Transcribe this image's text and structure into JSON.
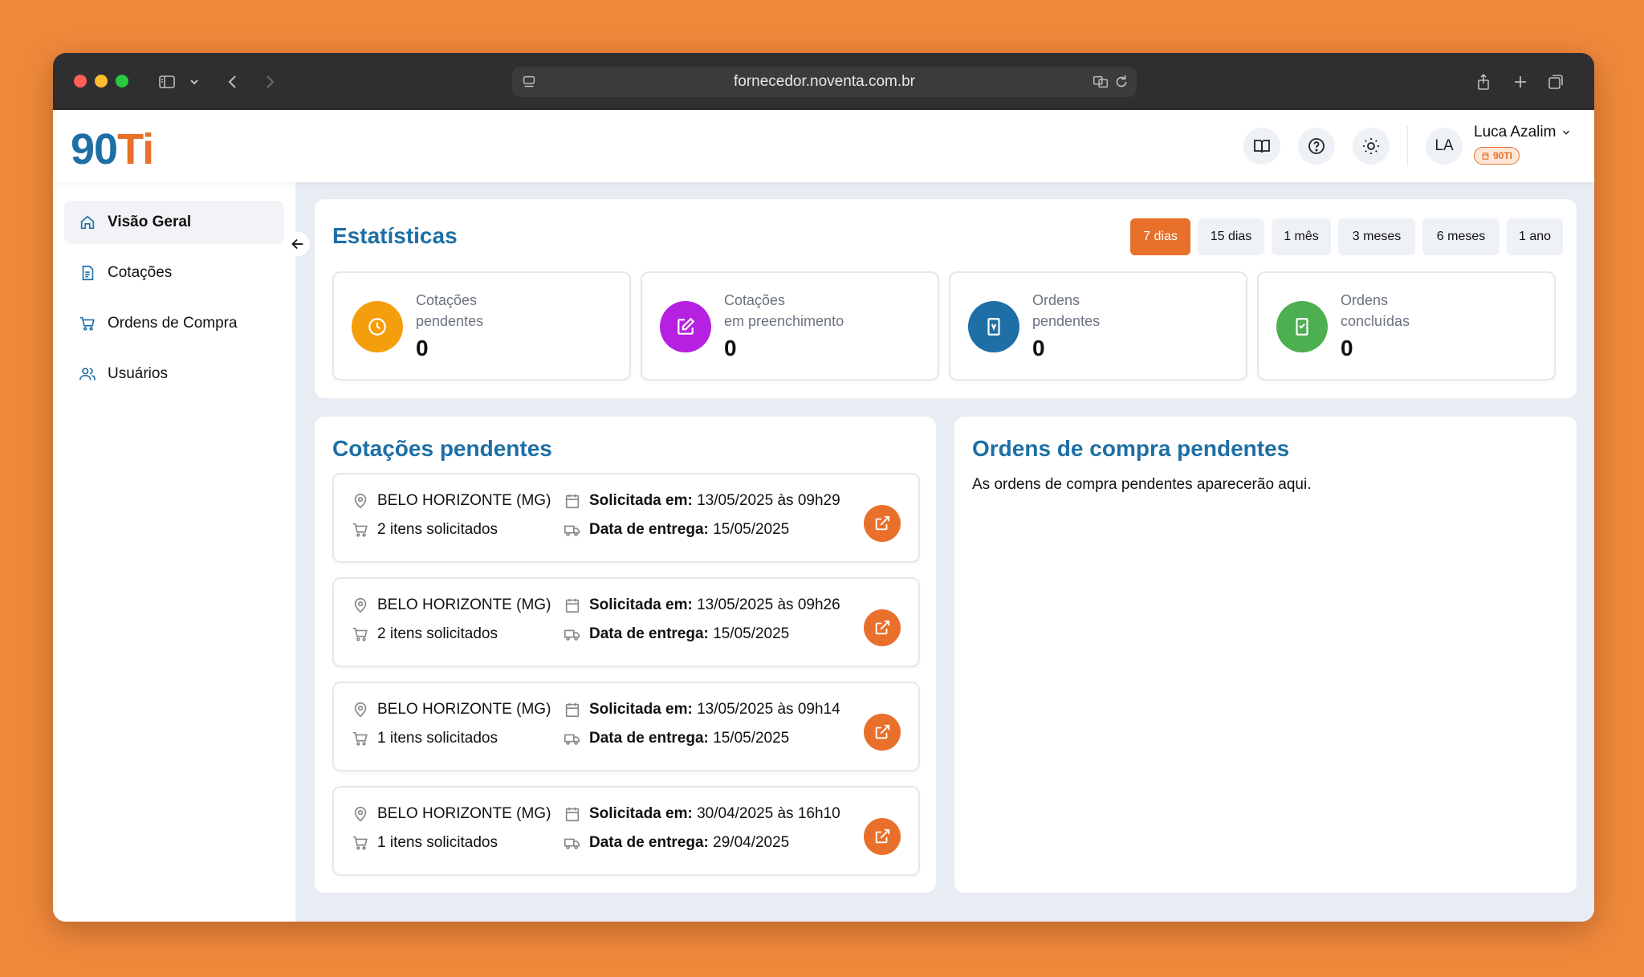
{
  "browser": {
    "url": "fornecedor.noventa.com.br"
  },
  "header": {
    "logo_part1": "90",
    "logo_part2": "Ti",
    "user_initials": "LA",
    "user_name": "Luca Azalim",
    "user_badge": "90TI"
  },
  "sidebar": {
    "items": [
      {
        "label": "Visão Geral",
        "icon": "home-icon"
      },
      {
        "label": "Cotações",
        "icon": "document-icon"
      },
      {
        "label": "Ordens de Compra",
        "icon": "cart-icon"
      },
      {
        "label": "Usuários",
        "icon": "users-icon"
      }
    ]
  },
  "stats": {
    "title": "Estatísticas",
    "ranges": [
      "7 dias",
      "15 dias",
      "1 mês",
      "3 meses",
      "6 meses",
      "1 ano"
    ],
    "selected_range": "7 dias",
    "cards": [
      {
        "line1": "Cotações",
        "line2": "pendentes",
        "value": "0",
        "color": "#F59E0B",
        "icon": "clock-icon"
      },
      {
        "line1": "Cotações",
        "line2": "em preenchimento",
        "value": "0",
        "color": "#B620E0",
        "icon": "edit-icon"
      },
      {
        "line1": "Ordens",
        "line2": "pendentes",
        "value": "0",
        "color": "#1D6FA5",
        "icon": "bookmark-icon"
      },
      {
        "line1": "Ordens",
        "line2": "concluídas",
        "value": "0",
        "color": "#4CAF50",
        "icon": "bookmark-check-icon"
      }
    ]
  },
  "pending_quotes": {
    "title": "Cotações pendentes",
    "requested_label": "Solicitada em:",
    "delivery_label": "Data de entrega:",
    "items": [
      {
        "location": "BELO HORIZONTE (MG)",
        "items_count": "2 itens solicitados",
        "requested": " 13/05/2025 às 09h29",
        "delivery": " 15/05/2025"
      },
      {
        "location": "BELO HORIZONTE (MG)",
        "items_count": "2 itens solicitados",
        "requested": " 13/05/2025 às 09h26",
        "delivery": " 15/05/2025"
      },
      {
        "location": "BELO HORIZONTE (MG)",
        "items_count": "1 itens solicitados",
        "requested": " 13/05/2025 às 09h14",
        "delivery": " 15/05/2025"
      },
      {
        "location": "BELO HORIZONTE (MG)",
        "items_count": "1 itens solicitados",
        "requested": " 30/04/2025 às 16h10",
        "delivery": " 29/04/2025"
      }
    ]
  },
  "pending_orders": {
    "title": "Ordens de compra pendentes",
    "empty_text": "As ordens de compra pendentes aparecerão aqui."
  },
  "colors": {
    "accent": "#E8702A",
    "brand_blue": "#1D6FA5",
    "background": "#F0883A"
  }
}
